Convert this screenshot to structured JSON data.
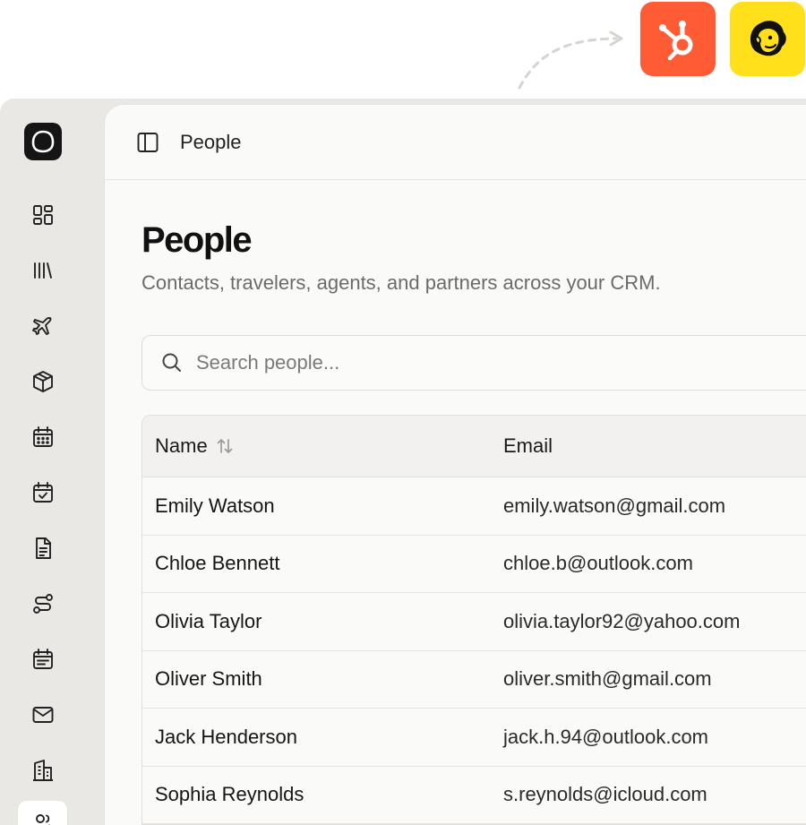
{
  "integrations": [
    {
      "name": "HubSpot",
      "icon": "hubspot-logo-icon",
      "color": "#ff5c35"
    },
    {
      "name": "Mailchimp",
      "icon": "mailchimp-logo-icon",
      "color": "#ffe01b"
    }
  ],
  "sidebar": {
    "items": [
      {
        "icon": "dashboard-grid-icon"
      },
      {
        "icon": "library-icon"
      },
      {
        "icon": "plane-icon"
      },
      {
        "icon": "package-icon"
      },
      {
        "icon": "calendar-icon"
      },
      {
        "icon": "calendar-check-icon"
      },
      {
        "icon": "document-icon"
      },
      {
        "icon": "route-icon"
      },
      {
        "icon": "calendar-schedule-icon"
      },
      {
        "icon": "mail-icon"
      },
      {
        "icon": "building-icon"
      },
      {
        "icon": "people-icon",
        "active": true
      }
    ]
  },
  "header": {
    "breadcrumb": "People"
  },
  "page": {
    "title": "People",
    "subtitle": "Contacts, travelers, agents, and partners across your CRM."
  },
  "search": {
    "placeholder": "Search people...",
    "value": ""
  },
  "table": {
    "columns": [
      "Name",
      "Email"
    ],
    "rows": [
      {
        "name": "Emily Watson",
        "email": "emily.watson@gmail.com"
      },
      {
        "name": "Chloe Bennett",
        "email": "chloe.b@outlook.com"
      },
      {
        "name": "Olivia Taylor",
        "email": "olivia.taylor92@yahoo.com"
      },
      {
        "name": "Oliver Smith",
        "email": "oliver.smith@gmail.com"
      },
      {
        "name": "Jack Henderson",
        "email": "jack.h.94@outlook.com"
      },
      {
        "name": "Sophia Reynolds",
        "email": "s.reynolds@icloud.com"
      }
    ]
  },
  "colors": {
    "accent": "#151515",
    "rail_bg": "#e9e8e4",
    "main_bg": "#fafaf9",
    "muted_text": "#6b6b6b"
  }
}
